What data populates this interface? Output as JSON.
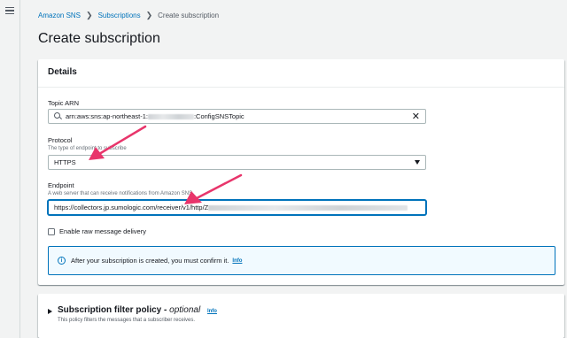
{
  "breadcrumb": {
    "items": [
      "Amazon SNS",
      "Subscriptions"
    ],
    "current": "Create subscription"
  },
  "page": {
    "title": "Create subscription"
  },
  "details": {
    "title": "Details",
    "topic_arn": {
      "label": "Topic ARN",
      "value_prefix": "arn:aws:sns:ap-northeast-1:",
      "value_suffix": ":ConfigSNSTopic"
    },
    "protocol": {
      "label": "Protocol",
      "description": "The type of endpoint to subscribe",
      "selected": "HTTPS"
    },
    "endpoint": {
      "label": "Endpoint",
      "description": "A web server that can receive notifications from Amazon SNS",
      "value": "https://collectors.jp.sumologic.com/receiver/v1/http/Z"
    },
    "raw_delivery": {
      "label": "Enable raw message delivery",
      "checked": false
    },
    "alert": {
      "text": "After your subscription is created, you must confirm it.",
      "link": "Info"
    }
  },
  "filter_policy": {
    "title": "Subscription filter policy",
    "optional": "optional",
    "info": "Info",
    "description": "This policy filters the messages that a subscriber receives."
  },
  "colors": {
    "accent": "#0073bb",
    "annotation_arrow": "#e8356b",
    "background": "#f2f3f3"
  }
}
